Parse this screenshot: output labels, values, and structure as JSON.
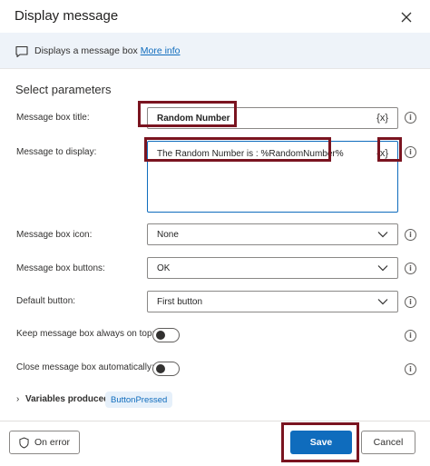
{
  "dialog": {
    "title": "Display message"
  },
  "info": {
    "text": "Displays a message box",
    "link": "More info"
  },
  "section_title": "Select parameters",
  "fields": {
    "title_label": "Message box title:",
    "title_value": "Random Number",
    "message_label": "Message to display:",
    "message_value": "The Random Number is : %RandomNumber%",
    "icon_label": "Message box icon:",
    "icon_value": "None",
    "buttons_label": "Message box buttons:",
    "buttons_value": "OK",
    "default_label": "Default button:",
    "default_value": "First button",
    "ontop_label": "Keep message box always on top:",
    "autoclose_label": "Close message box automatically:",
    "var_symbol": "{x}",
    "help_symbol": "i"
  },
  "toggles": {
    "ontop": false,
    "autoclose": false
  },
  "variables": {
    "label": "Variables produced",
    "chip": "ButtonPressed"
  },
  "footer": {
    "on_error": "On error",
    "save": "Save",
    "cancel": "Cancel"
  },
  "colors": {
    "accent": "#0f6cbd",
    "highlight_box": "#7a1420"
  }
}
